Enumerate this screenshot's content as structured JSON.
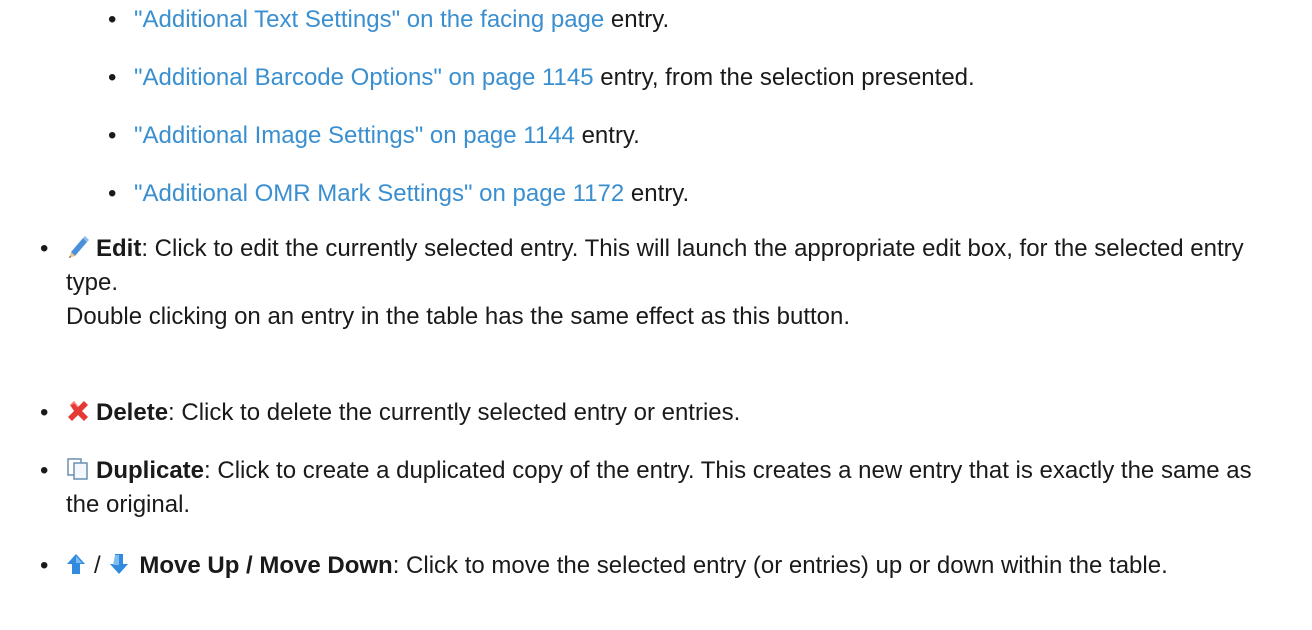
{
  "sub_items": [
    {
      "link": "\"Additional Text Settings\" on the facing page",
      "suffix": " entry."
    },
    {
      "link": "\"Additional Barcode Options\" on page 1145",
      "suffix": " entry, from the selection presented."
    },
    {
      "link": "\"Additional Image Settings\" on page 1144",
      "suffix": " entry."
    },
    {
      "link": "\"Additional OMR Mark Settings\" on page 1172",
      "suffix": " entry."
    }
  ],
  "edit": {
    "icon": "pencil-icon",
    "label": "Edit",
    "text": ": Click to edit the currently selected entry. This will launch the appropriate edit box, for the selected entry type.",
    "note": "Double clicking on an entry in the table has the same effect as this button."
  },
  "delete": {
    "icon": "red-x-icon",
    "label": "Delete",
    "text": ": Click to delete the currently selected entry or entries."
  },
  "duplicate": {
    "icon": "copy-icon",
    "label": "Duplicate",
    "text": ": Click to create a duplicated copy of the entry. This creates a new entry that is exactly the same as the original."
  },
  "move": {
    "icon_up": "arrow-up-icon",
    "icon_down": "arrow-down-icon",
    "separator": "/",
    "label": "Move Up / Move Down",
    "text": ": Click to move the selected entry (or entries) up or down within the table."
  },
  "colors": {
    "link": "#3a8fd0",
    "text": "#1a1a1a",
    "arrow": "#2f8ae0",
    "delete": "#e53935"
  }
}
